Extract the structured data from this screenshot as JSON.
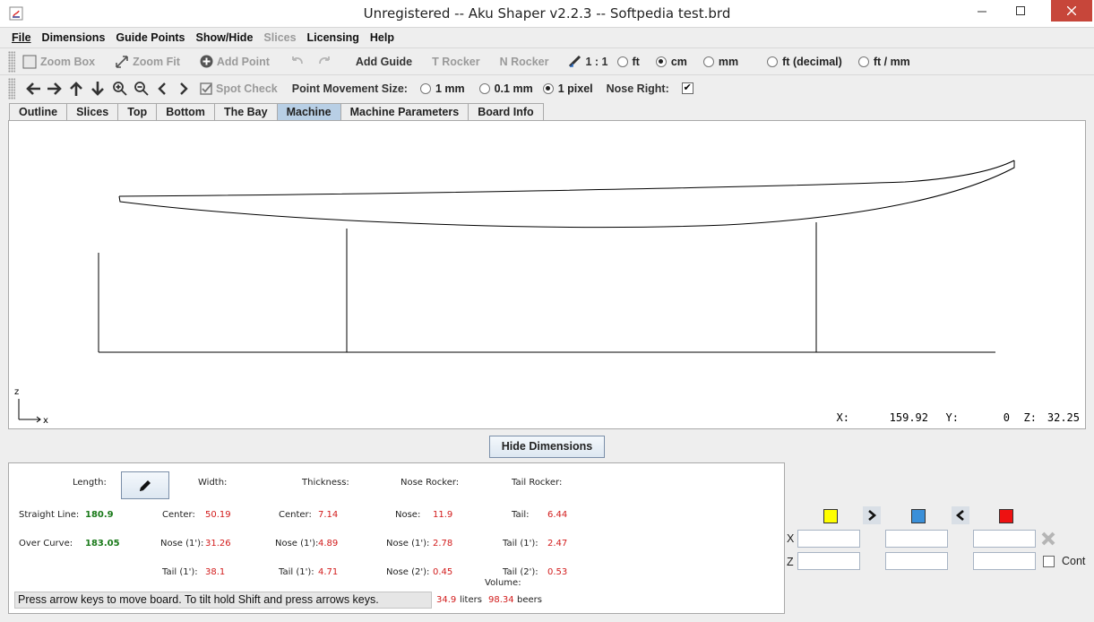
{
  "window": {
    "title": "Unregistered -- Aku Shaper v2.2.3  --  Softpedia test.brd"
  },
  "menu": [
    {
      "label": "File"
    },
    {
      "label": "Dimensions"
    },
    {
      "label": "Guide Points"
    },
    {
      "label": "Show/Hide"
    },
    {
      "label": "Slices",
      "disabled": true
    },
    {
      "label": "Licensing"
    },
    {
      "label": "Help"
    }
  ],
  "toolbar1": {
    "zoom_box": "Zoom Box",
    "zoom_fit": "Zoom Fit",
    "add_point": "Add Point",
    "add_guide": "Add Guide",
    "t_rocker": "T Rocker",
    "n_rocker": "N Rocker",
    "scale": "1 : 1",
    "units": [
      {
        "label": "ft",
        "selected": false
      },
      {
        "label": "cm",
        "selected": true
      },
      {
        "label": "mm",
        "selected": false
      },
      {
        "label": "ft (decimal)",
        "selected": false
      },
      {
        "label": "ft / mm",
        "selected": false
      }
    ]
  },
  "toolbar2": {
    "spot_check": "Spot Check",
    "point_movement_label": "Point Movement Size:",
    "sizes": [
      {
        "label": "1 mm",
        "selected": false
      },
      {
        "label": "0.1 mm",
        "selected": false
      },
      {
        "label": "1 pixel",
        "selected": true
      }
    ],
    "nose_right_label": "Nose Right:",
    "nose_right_checked": "✔"
  },
  "tabs": [
    {
      "label": "Outline",
      "active": false
    },
    {
      "label": "Slices",
      "active": false
    },
    {
      "label": "Top",
      "active": false
    },
    {
      "label": "Bottom",
      "active": false
    },
    {
      "label": "The Bay",
      "active": false
    },
    {
      "label": "Machine",
      "active": true
    },
    {
      "label": "Machine Parameters",
      "active": false
    },
    {
      "label": "Board Info",
      "active": false
    }
  ],
  "canvas": {
    "axis_z": "z",
    "axis_x": "x",
    "coords": {
      "x_label": "X:",
      "x_value": "159.92",
      "y_label": "Y:",
      "y_value": "0",
      "z_label": "Z:",
      "z_value": "32.25"
    }
  },
  "hide_dimensions": "Hide Dimensions",
  "dimensions": {
    "length_label": "Length:",
    "width_label": "Width:",
    "thickness_label": "Thickness:",
    "nose_rocker_label": "Nose Rocker:",
    "tail_rocker_label": "Tail Rocker:",
    "straight_line_label": "Straight Line:",
    "straight_line_value": "180.9",
    "over_curve_label": "Over Curve:",
    "over_curve_value": "183.05",
    "width_center_label": "Center:",
    "width_center": "50.19",
    "width_nose_label": "Nose (1'):",
    "width_nose": "31.26",
    "width_tail_label": "Tail (1'):",
    "width_tail": "38.1",
    "thick_center_label": "Center:",
    "thick_center": "7.14",
    "thick_nose_label": "Nose (1'):",
    "thick_nose": "4.89",
    "thick_tail_label": "Tail (1'):",
    "thick_tail": "4.71",
    "nrock_nose_label": "Nose:",
    "nrock_nose": "11.9",
    "nrock_nose1_label": "Nose (1'):",
    "nrock_nose1": "2.78",
    "nrock_nose2_label": "Nose (2'):",
    "nrock_nose2": "0.45",
    "trock_tail_label": "Tail:",
    "trock_tail": "6.44",
    "trock_tail1_label": "Tail (1'):",
    "trock_tail1": "2.47",
    "trock_tail2_label": "Tail (2'):",
    "trock_tail2": "0.53",
    "volume_label": "Volume:",
    "volume_liters": "34.9",
    "liters_label": "liters",
    "volume_beers": "98.34",
    "beers_label": "beers"
  },
  "status": "Press arrow keys to move board. To tilt hold Shift and press arrows keys.",
  "controls": {
    "x_label": "X",
    "z_label": "Z",
    "cont_label": "Cont",
    "swatch_colors": [
      "#ffff00",
      "#3a8fd8",
      "#ee1111"
    ]
  }
}
